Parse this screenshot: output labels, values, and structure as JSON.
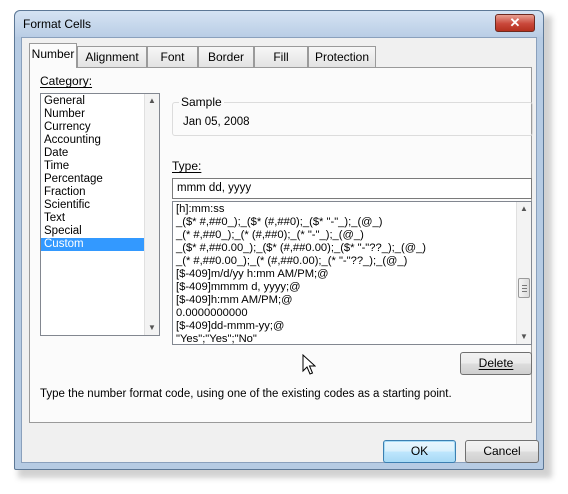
{
  "window": {
    "title": "Format Cells",
    "close_glyph": "✕"
  },
  "tabs": [
    {
      "label": "Number",
      "active": true
    },
    {
      "label": "Alignment"
    },
    {
      "label": "Font"
    },
    {
      "label": "Border"
    },
    {
      "label": "Fill"
    },
    {
      "label": "Protection"
    }
  ],
  "category": {
    "label": "Category:",
    "items": [
      "General",
      "Number",
      "Currency",
      "Accounting",
      "Date",
      "Time",
      "Percentage",
      "Fraction",
      "Scientific",
      "Text",
      "Special",
      "Custom"
    ],
    "selected": "Custom"
  },
  "sample": {
    "label": "Sample",
    "value": "Jan 05, 2008"
  },
  "type": {
    "label": "Type:",
    "value": "mmm dd, yyyy",
    "formats": [
      "[h]:mm:ss",
      "_($* #,##0_);_($* (#,##0);_($* \"-\"_);_(@_)",
      "_(* #,##0_);_(* (#,##0);_(* \"-\"_);_(@_)",
      "_($* #,##0.00_);_($* (#,##0.00);_($* \"-\"??_);_(@_)",
      "_(* #,##0.00_);_(* (#,##0.00);_(* \"-\"??_);_(@_)",
      "[$-409]m/d/yy h:mm AM/PM;@",
      "[$-409]mmmm d, yyyy;@",
      "[$-409]h:mm AM/PM;@",
      "0.0000000000",
      "[$-409]dd-mmm-yy;@",
      "\"Yes\";\"Yes\";\"No\""
    ]
  },
  "buttons": {
    "delete": "Delete",
    "ok": "OK",
    "cancel": "Cancel"
  },
  "hint": "Type the number format code, using one of the existing codes as a starting point.",
  "colors": {
    "selection": "#3399ff",
    "frame": "#b6cbe3",
    "close": "#c9473a"
  },
  "icons": {
    "close": "close-icon",
    "scroll_up": "scroll-up-arrow-icon",
    "scroll_down": "scroll-down-arrow-icon",
    "cursor": "mouse-pointer-icon"
  }
}
